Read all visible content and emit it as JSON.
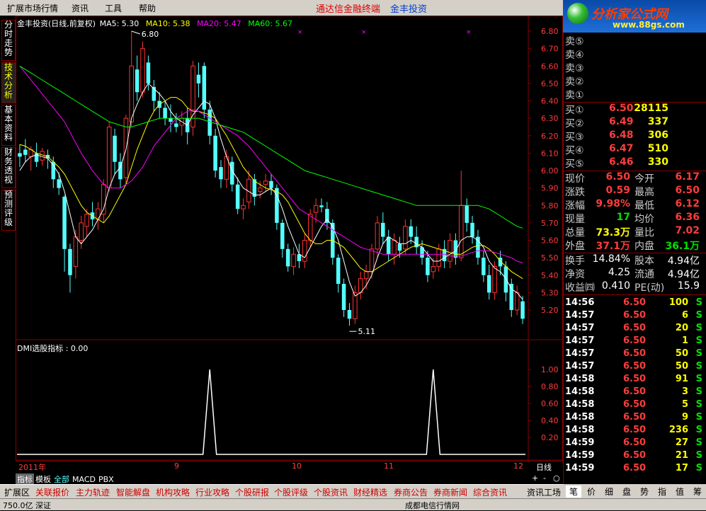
{
  "menubar": {
    "items": [
      "扩展市场行情",
      "资讯",
      "工具",
      "帮助"
    ],
    "ad_red": "通达信金融终端",
    "ad_blue": "金丰投资"
  },
  "logo": {
    "brand": "分析家公式网",
    "url": "www.88gs.com"
  },
  "left_tabs": [
    "分时走势",
    "技术分析",
    "基本资料",
    "财务透视",
    "预测评级"
  ],
  "chart_header": {
    "title": "金丰投资(日线,前复权)",
    "ma5": "MA5: 5.30",
    "ma10": "MA10: 5.38",
    "ma20": "MA20: 5.47",
    "ma60": "MA60: 5.67",
    "high_label": "6.80",
    "low_label": "5.11",
    "colors": {
      "ma5": "#ffffff",
      "ma10": "#ffff00",
      "ma20": "#ff00ff",
      "ma60": "#00ff00",
      "up": "#ff3232",
      "down": "#54ffff"
    }
  },
  "price_axis": [
    "6.80",
    "6.70",
    "6.60",
    "6.50",
    "6.40",
    "6.30",
    "6.20",
    "6.10",
    "6.00",
    "5.90",
    "5.80",
    "5.70",
    "5.60",
    "5.50",
    "5.40",
    "5.30",
    "5.20"
  ],
  "dmi": {
    "title": "DMI选股指标 : 0.00",
    "axis": [
      "1.00",
      "0.80",
      "0.60",
      "0.40",
      "0.20"
    ]
  },
  "dates": {
    "year": "2011年",
    "m9": "9",
    "m10": "10",
    "m11": "11",
    "m12": "12",
    "period": "日线"
  },
  "bottom_tabs": [
    "指标",
    "模板",
    "全部",
    "MACD",
    "PBX"
  ],
  "zoom": {
    "plus": "+",
    "minus": "-",
    "o": "○"
  },
  "navbar": [
    "扩展区",
    "关联报价",
    "主力轨迹",
    "智能解盘",
    "机构攻略",
    "行业攻略",
    "个股研报",
    "个股评级",
    "个股资讯",
    "财经精选",
    "券商公告",
    "券商新闻",
    "综合资讯",
    "资讯工场"
  ],
  "status_left": "750.0亿 深证",
  "status_mid": "成都电信行情网",
  "orderbook": {
    "sell": [
      "卖⑤",
      "卖④",
      "卖③",
      "卖②",
      "卖①"
    ],
    "buy": [
      {
        "label": "买①",
        "price": "6.50",
        "vol": "28115"
      },
      {
        "label": "买②",
        "price": "6.49",
        "vol": "337"
      },
      {
        "label": "买③",
        "price": "6.48",
        "vol": "306"
      },
      {
        "label": "买④",
        "price": "6.47",
        "vol": "510"
      },
      {
        "label": "买⑤",
        "price": "6.46",
        "vol": "330"
      }
    ]
  },
  "quote": [
    {
      "l1": "现价",
      "v1": "6.50",
      "c1": "red",
      "l2": "今开",
      "v2": "6.17",
      "c2": "red"
    },
    {
      "l1": "涨跌",
      "v1": "0.59",
      "c1": "red",
      "l2": "最高",
      "v2": "6.50",
      "c2": "red"
    },
    {
      "l1": "涨幅",
      "v1": "9.98%",
      "c1": "red",
      "l2": "最低",
      "v2": "6.12",
      "c2": "red"
    },
    {
      "l1": "现量",
      "v1": "17",
      "c1": "grn",
      "l2": "均价",
      "v2": "6.36",
      "c2": "red"
    },
    {
      "l1": "总量",
      "v1": "73.3万",
      "c1": "yel",
      "l2": "量比",
      "v2": "7.02",
      "c2": "red"
    },
    {
      "l1": "外盘",
      "v1": "37.1万",
      "c1": "red",
      "l2": "内盘",
      "v2": "36.1万",
      "c2": "grn"
    }
  ],
  "fundamentals": [
    {
      "l1": "换手",
      "v1": "14.84%",
      "l2": "股本",
      "v2": "4.94亿"
    },
    {
      "l1": "净资",
      "v1": "4.25",
      "l2": "流通",
      "v2": "4.94亿"
    },
    {
      "l1": "收益㈣",
      "v1": "0.410",
      "l2": "PE(动)",
      "v2": "15.9"
    }
  ],
  "ticks": [
    {
      "t": "14:56",
      "p": "6.50",
      "v": "100",
      "s": "S"
    },
    {
      "t": "14:57",
      "p": "6.50",
      "v": "6",
      "s": "S"
    },
    {
      "t": "14:57",
      "p": "6.50",
      "v": "20",
      "s": "S"
    },
    {
      "t": "14:57",
      "p": "6.50",
      "v": "1",
      "s": "S"
    },
    {
      "t": "14:57",
      "p": "6.50",
      "v": "50",
      "s": "S"
    },
    {
      "t": "14:57",
      "p": "6.50",
      "v": "50",
      "s": "S"
    },
    {
      "t": "14:58",
      "p": "6.50",
      "v": "91",
      "s": "S"
    },
    {
      "t": "14:58",
      "p": "6.50",
      "v": "3",
      "s": "S"
    },
    {
      "t": "14:58",
      "p": "6.50",
      "v": "5",
      "s": "S"
    },
    {
      "t": "14:58",
      "p": "6.50",
      "v": "9",
      "s": "S"
    },
    {
      "t": "14:58",
      "p": "6.50",
      "v": "236",
      "s": "S"
    },
    {
      "t": "14:59",
      "p": "6.50",
      "v": "27",
      "s": "S"
    },
    {
      "t": "14:59",
      "p": "6.50",
      "v": "21",
      "s": "S"
    },
    {
      "t": "14:59",
      "p": "6.50",
      "v": "17",
      "s": "S"
    }
  ],
  "right_tabs": [
    "笔",
    "价",
    "细",
    "盘",
    "势",
    "指",
    "值",
    "筹"
  ],
  "chart_data": {
    "type": "candlestick",
    "ylim": [
      5.11,
      6.8
    ],
    "candles": [
      {
        "o": 6.1,
        "c": 6.08,
        "h": 6.15,
        "l": 6.02
      },
      {
        "o": 6.12,
        "c": 6.09,
        "h": 6.18,
        "l": 6.05
      },
      {
        "o": 6.08,
        "c": 6.12,
        "h": 6.14,
        "l": 6.0
      },
      {
        "o": 6.1,
        "c": 6.05,
        "h": 6.16,
        "l": 6.02
      },
      {
        "o": 6.06,
        "c": 6.11,
        "h": 6.13,
        "l": 6.03
      },
      {
        "o": 6.09,
        "c": 6.07,
        "h": 6.12,
        "l": 6.01
      },
      {
        "o": 6.05,
        "c": 5.95,
        "h": 6.08,
        "l": 5.9
      },
      {
        "o": 5.95,
        "c": 5.9,
        "h": 5.99,
        "l": 5.86
      },
      {
        "o": 5.85,
        "c": 5.55,
        "h": 5.86,
        "l": 5.42
      },
      {
        "o": 5.55,
        "c": 5.4,
        "h": 5.58,
        "l": 5.3
      },
      {
        "o": 5.45,
        "c": 5.62,
        "h": 5.66,
        "l": 5.38
      },
      {
        "o": 5.6,
        "c": 5.7,
        "h": 5.74,
        "l": 5.55
      },
      {
        "o": 5.68,
        "c": 5.75,
        "h": 5.78,
        "l": 5.62
      },
      {
        "o": 5.76,
        "c": 5.72,
        "h": 5.82,
        "l": 5.68
      },
      {
        "o": 5.72,
        "c": 5.78,
        "h": 5.82,
        "l": 5.66
      },
      {
        "o": 5.75,
        "c": 5.92,
        "h": 5.95,
        "l": 5.7
      },
      {
        "o": 5.9,
        "c": 6.25,
        "h": 6.28,
        "l": 5.88
      },
      {
        "o": 6.2,
        "c": 6.05,
        "h": 6.24,
        "l": 5.98
      },
      {
        "o": 6.05,
        "c": 5.95,
        "h": 6.1,
        "l": 5.9
      },
      {
        "o": 5.96,
        "c": 6.3,
        "h": 6.32,
        "l": 5.92
      },
      {
        "o": 6.28,
        "c": 6.6,
        "h": 6.8,
        "l": 6.25
      },
      {
        "o": 6.58,
        "c": 6.45,
        "h": 6.66,
        "l": 6.4
      },
      {
        "o": 6.45,
        "c": 6.7,
        "h": 6.74,
        "l": 6.42
      },
      {
        "o": 6.62,
        "c": 6.5,
        "h": 6.66,
        "l": 6.46
      },
      {
        "o": 6.48,
        "c": 6.4,
        "h": 6.52,
        "l": 6.34
      },
      {
        "o": 6.4,
        "c": 6.36,
        "h": 6.45,
        "l": 6.3
      },
      {
        "o": 6.36,
        "c": 6.3,
        "h": 6.4,
        "l": 6.26
      },
      {
        "o": 6.3,
        "c": 6.28,
        "h": 6.38,
        "l": 6.22
      },
      {
        "o": 6.27,
        "c": 6.25,
        "h": 6.33,
        "l": 6.22
      },
      {
        "o": 6.26,
        "c": 6.3,
        "h": 6.34,
        "l": 6.2
      },
      {
        "o": 6.3,
        "c": 6.22,
        "h": 6.36,
        "l": 6.15
      },
      {
        "o": 6.25,
        "c": 6.6,
        "h": 6.63,
        "l": 6.2
      },
      {
        "o": 6.55,
        "c": 6.5,
        "h": 6.62,
        "l": 6.42
      },
      {
        "o": 6.6,
        "c": 6.35,
        "h": 6.62,
        "l": 6.3
      },
      {
        "o": 6.35,
        "c": 6.2,
        "h": 6.4,
        "l": 6.15
      },
      {
        "o": 6.2,
        "c": 6.0,
        "h": 6.24,
        "l": 5.96
      },
      {
        "o": 6.02,
        "c": 5.95,
        "h": 6.06,
        "l": 5.9
      },
      {
        "o": 5.95,
        "c": 6.08,
        "h": 6.12,
        "l": 5.9
      },
      {
        "o": 6.05,
        "c": 5.92,
        "h": 6.08,
        "l": 5.88
      },
      {
        "o": 5.92,
        "c": 5.78,
        "h": 5.96,
        "l": 5.75
      },
      {
        "o": 5.78,
        "c": 5.8,
        "h": 5.84,
        "l": 5.72
      },
      {
        "o": 5.82,
        "c": 5.95,
        "h": 6.0,
        "l": 5.78
      },
      {
        "o": 5.95,
        "c": 5.85,
        "h": 5.98,
        "l": 5.8
      },
      {
        "o": 5.88,
        "c": 5.9,
        "h": 5.94,
        "l": 5.84
      },
      {
        "o": 5.92,
        "c": 5.94,
        "h": 5.98,
        "l": 5.88
      },
      {
        "o": 5.94,
        "c": 5.9,
        "h": 5.98,
        "l": 5.86
      },
      {
        "o": 5.9,
        "c": 5.7,
        "h": 5.92,
        "l": 5.66
      },
      {
        "o": 5.7,
        "c": 5.55,
        "h": 5.72,
        "l": 5.5
      },
      {
        "o": 5.55,
        "c": 5.45,
        "h": 5.58,
        "l": 5.42
      },
      {
        "o": 5.45,
        "c": 5.52,
        "h": 5.56,
        "l": 5.4
      },
      {
        "o": 5.52,
        "c": 5.48,
        "h": 5.58,
        "l": 5.44
      },
      {
        "o": 5.48,
        "c": 5.6,
        "h": 5.64,
        "l": 5.44
      },
      {
        "o": 5.6,
        "c": 5.75,
        "h": 5.78,
        "l": 5.56
      },
      {
        "o": 5.76,
        "c": 5.8,
        "h": 5.84,
        "l": 5.7
      },
      {
        "o": 5.8,
        "c": 5.79,
        "h": 5.84,
        "l": 5.76
      },
      {
        "o": 5.78,
        "c": 5.7,
        "h": 5.82,
        "l": 5.66
      },
      {
        "o": 5.7,
        "c": 5.5,
        "h": 5.72,
        "l": 5.46
      },
      {
        "o": 5.5,
        "c": 5.35,
        "h": 5.52,
        "l": 5.3
      },
      {
        "o": 5.35,
        "c": 5.2,
        "h": 5.38,
        "l": 5.16
      },
      {
        "o": 5.2,
        "c": 5.15,
        "h": 5.24,
        "l": 5.11
      },
      {
        "o": 5.15,
        "c": 5.3,
        "h": 5.34,
        "l": 5.12
      },
      {
        "o": 5.3,
        "c": 5.38,
        "h": 5.42,
        "l": 5.26
      },
      {
        "o": 5.38,
        "c": 5.42,
        "h": 5.46,
        "l": 5.32
      },
      {
        "o": 5.42,
        "c": 5.55,
        "h": 5.58,
        "l": 5.38
      },
      {
        "o": 5.55,
        "c": 5.7,
        "h": 5.74,
        "l": 5.5
      },
      {
        "o": 5.7,
        "c": 5.62,
        "h": 5.76,
        "l": 5.58
      },
      {
        "o": 5.62,
        "c": 5.52,
        "h": 5.66,
        "l": 5.48
      },
      {
        "o": 5.52,
        "c": 5.6,
        "h": 5.64,
        "l": 5.46
      },
      {
        "o": 5.58,
        "c": 5.54,
        "h": 5.62,
        "l": 5.5
      },
      {
        "o": 5.55,
        "c": 5.68,
        "h": 5.72,
        "l": 5.52
      },
      {
        "o": 5.68,
        "c": 5.62,
        "h": 5.72,
        "l": 5.58
      },
      {
        "o": 5.62,
        "c": 5.56,
        "h": 5.68,
        "l": 5.52
      },
      {
        "o": 5.56,
        "c": 5.5,
        "h": 5.6,
        "l": 5.46
      },
      {
        "o": 5.5,
        "c": 5.4,
        "h": 5.54,
        "l": 5.36
      },
      {
        "o": 5.42,
        "c": 5.45,
        "h": 5.5,
        "l": 5.38
      },
      {
        "o": 5.45,
        "c": 5.55,
        "h": 5.58,
        "l": 5.42
      },
      {
        "o": 5.55,
        "c": 5.48,
        "h": 5.6,
        "l": 5.44
      },
      {
        "o": 5.48,
        "c": 5.6,
        "h": 5.64,
        "l": 5.44
      },
      {
        "o": 5.6,
        "c": 5.5,
        "h": 5.64,
        "l": 5.46
      },
      {
        "o": 5.5,
        "c": 5.8,
        "h": 6.0,
        "l": 5.48
      },
      {
        "o": 5.8,
        "c": 5.7,
        "h": 5.84,
        "l": 5.65
      },
      {
        "o": 5.7,
        "c": 5.62,
        "h": 5.74,
        "l": 5.58
      },
      {
        "o": 5.62,
        "c": 5.5,
        "h": 5.66,
        "l": 5.46
      },
      {
        "o": 5.5,
        "c": 5.4,
        "h": 5.54,
        "l": 5.36
      },
      {
        "o": 5.4,
        "c": 5.3,
        "h": 5.46,
        "l": 5.26
      },
      {
        "o": 5.3,
        "c": 5.45,
        "h": 5.48,
        "l": 5.26
      },
      {
        "o": 5.5,
        "c": 5.45,
        "h": 5.54,
        "l": 5.4
      },
      {
        "o": 5.45,
        "c": 5.3,
        "h": 5.48,
        "l": 5.25
      },
      {
        "o": 5.35,
        "c": 5.2,
        "h": 5.38,
        "l": 5.16
      },
      {
        "o": 5.2,
        "c": 5.3,
        "h": 5.34,
        "l": 5.17
      },
      {
        "o": 5.25,
        "c": 5.15,
        "h": 5.28,
        "l": 5.12
      }
    ],
    "ma": {
      "MA5": [
        6.0,
        6.05,
        6.08,
        6.09,
        6.08,
        6.07,
        6.03,
        5.98,
        5.88,
        5.75,
        5.62,
        5.58,
        5.62,
        5.66,
        5.72,
        5.78,
        5.9,
        5.98,
        6.02,
        6.12,
        6.3,
        6.38,
        6.45,
        6.5,
        6.47,
        6.44,
        6.4,
        6.34,
        6.3,
        6.28,
        6.26,
        6.32,
        6.36,
        6.4,
        6.38,
        6.3,
        6.18,
        6.08,
        6.0,
        5.95,
        5.9,
        5.88,
        5.86,
        5.86,
        5.88,
        5.9,
        5.86,
        5.78,
        5.68,
        5.6,
        5.52,
        5.5,
        5.56,
        5.62,
        5.68,
        5.72,
        5.68,
        5.6,
        5.48,
        5.36,
        5.28,
        5.3,
        5.34,
        5.4,
        5.5,
        5.58,
        5.62,
        5.6,
        5.58,
        5.58,
        5.6,
        5.58,
        5.56,
        5.52,
        5.48,
        5.48,
        5.5,
        5.52,
        5.54,
        5.6,
        5.62,
        5.62,
        5.6,
        5.56,
        5.48,
        5.44,
        5.42,
        5.38,
        5.32,
        5.3,
        5.26
      ],
      "MA10": [
        6.15,
        6.14,
        6.12,
        6.1,
        6.09,
        6.08,
        6.05,
        6.02,
        5.98,
        5.92,
        5.86,
        5.8,
        5.76,
        5.74,
        5.72,
        5.7,
        5.74,
        5.8,
        5.86,
        5.92,
        6.02,
        6.12,
        6.2,
        6.28,
        6.34,
        6.38,
        6.4,
        6.42,
        6.42,
        6.4,
        6.36,
        6.34,
        6.34,
        6.33,
        6.32,
        6.3,
        6.25,
        6.2,
        6.14,
        6.08,
        6.02,
        5.98,
        5.94,
        5.92,
        5.9,
        5.89,
        5.88,
        5.86,
        5.82,
        5.76,
        5.7,
        5.64,
        5.6,
        5.58,
        5.58,
        5.6,
        5.6,
        5.58,
        5.56,
        5.52,
        5.48,
        5.44,
        5.42,
        5.42,
        5.44,
        5.46,
        5.48,
        5.5,
        5.52,
        5.54,
        5.56,
        5.57,
        5.58,
        5.57,
        5.56,
        5.55,
        5.54,
        5.53,
        5.52,
        5.52,
        5.54,
        5.56,
        5.57,
        5.57,
        5.55,
        5.52,
        5.48,
        5.45,
        5.42,
        5.4,
        5.38
      ],
      "MA20": [
        6.6,
        6.56,
        6.52,
        6.48,
        6.44,
        6.4,
        6.36,
        6.32,
        6.28,
        6.22,
        6.16,
        6.1,
        6.05,
        6.0,
        5.96,
        5.92,
        5.9,
        5.9,
        5.9,
        5.92,
        5.94,
        5.98,
        6.02,
        6.08,
        6.14,
        6.18,
        6.22,
        6.26,
        6.3,
        6.32,
        6.34,
        6.35,
        6.34,
        6.32,
        6.3,
        6.28,
        6.26,
        6.24,
        6.22,
        6.2,
        6.17,
        6.14,
        6.1,
        6.06,
        6.02,
        5.98,
        5.94,
        5.9,
        5.86,
        5.82,
        5.78,
        5.76,
        5.74,
        5.72,
        5.7,
        5.68,
        5.66,
        5.64,
        5.62,
        5.6,
        5.58,
        5.56,
        5.55,
        5.54,
        5.53,
        5.52,
        5.52,
        5.52,
        5.52,
        5.52,
        5.52,
        5.52,
        5.52,
        5.52,
        5.52,
        5.52,
        5.52,
        5.51,
        5.51,
        5.51,
        5.52,
        5.53,
        5.54,
        5.54,
        5.54,
        5.53,
        5.52,
        5.51,
        5.5,
        5.48,
        5.47
      ],
      "MA60": [
        6.6,
        6.58,
        6.56,
        6.54,
        6.52,
        6.5,
        6.48,
        6.46,
        6.44,
        6.42,
        6.4,
        6.38,
        6.36,
        6.34,
        6.32,
        6.3,
        6.28,
        6.27,
        6.26,
        6.25,
        6.25,
        6.26,
        6.27,
        6.28,
        6.29,
        6.3,
        6.3,
        6.3,
        6.3,
        6.3,
        6.3,
        6.3,
        6.3,
        6.29,
        6.28,
        6.27,
        6.26,
        6.25,
        6.24,
        6.23,
        6.22,
        6.2,
        6.18,
        6.16,
        6.14,
        6.12,
        6.1,
        6.08,
        6.06,
        6.04,
        6.02,
        6.0,
        5.99,
        5.98,
        5.97,
        5.96,
        5.95,
        5.94,
        5.93,
        5.92,
        5.91,
        5.9,
        5.89,
        5.88,
        5.87,
        5.86,
        5.85,
        5.84,
        5.83,
        5.82,
        5.81,
        5.8,
        5.8,
        5.8,
        5.8,
        5.8,
        5.8,
        5.8,
        5.8,
        5.8,
        5.8,
        5.8,
        5.8,
        5.79,
        5.78,
        5.76,
        5.74,
        5.72,
        5.7,
        5.68,
        5.67
      ]
    },
    "dmi_signal": {
      "peaks": [
        34,
        74
      ]
    }
  }
}
